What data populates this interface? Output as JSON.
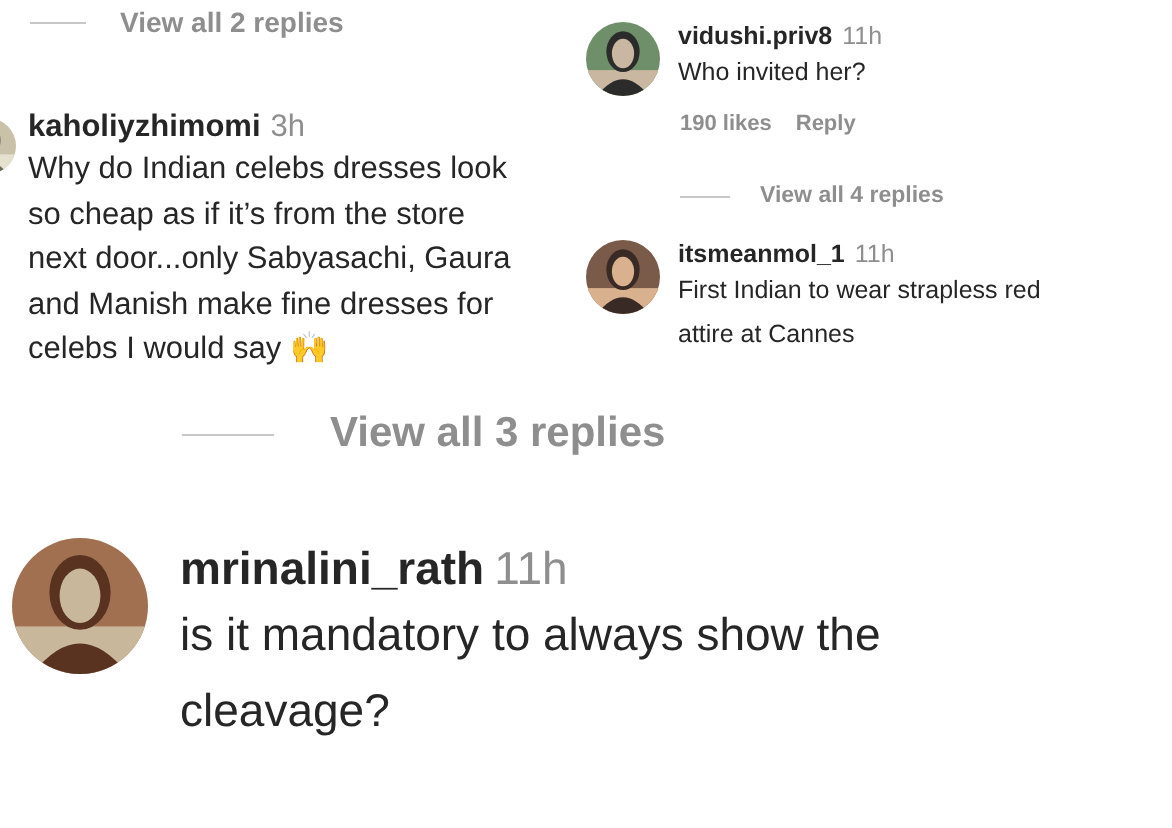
{
  "panels": [
    {
      "items": [
        {
          "kind": "view_replies",
          "text": "View all 2 replies"
        },
        {
          "kind": "comment",
          "username": "kaholiyzhimomi",
          "time": "3h",
          "lines": [
            "Why do Indian celebs dresses look",
            "so cheap as if it’s from the store",
            "next door...only Sabyasachi, Gaura",
            "and Manish make fine dresses for",
            "celebs I would say 🙌"
          ]
        }
      ]
    },
    {
      "items": [
        {
          "kind": "comment",
          "username": "vidushi.priv8",
          "time": "11h",
          "lines": [
            "Who invited her?"
          ]
        },
        {
          "kind": "actions",
          "likes": "190 likes",
          "reply": "Reply"
        },
        {
          "kind": "view_replies",
          "text": "View all 4 replies"
        },
        {
          "kind": "comment",
          "username": "itsmeanmol_1",
          "time": "11h",
          "lines": [
            "First Indian to wear strapless red",
            "attire at Cannes"
          ]
        }
      ]
    },
    {
      "items": [
        {
          "kind": "view_replies",
          "text": "View all 3 replies"
        },
        {
          "kind": "comment",
          "username": "mrinalini_rath",
          "time": "11h",
          "lines": [
            "is it mandatory to always show the",
            "cleavage?"
          ]
        }
      ]
    }
  ]
}
